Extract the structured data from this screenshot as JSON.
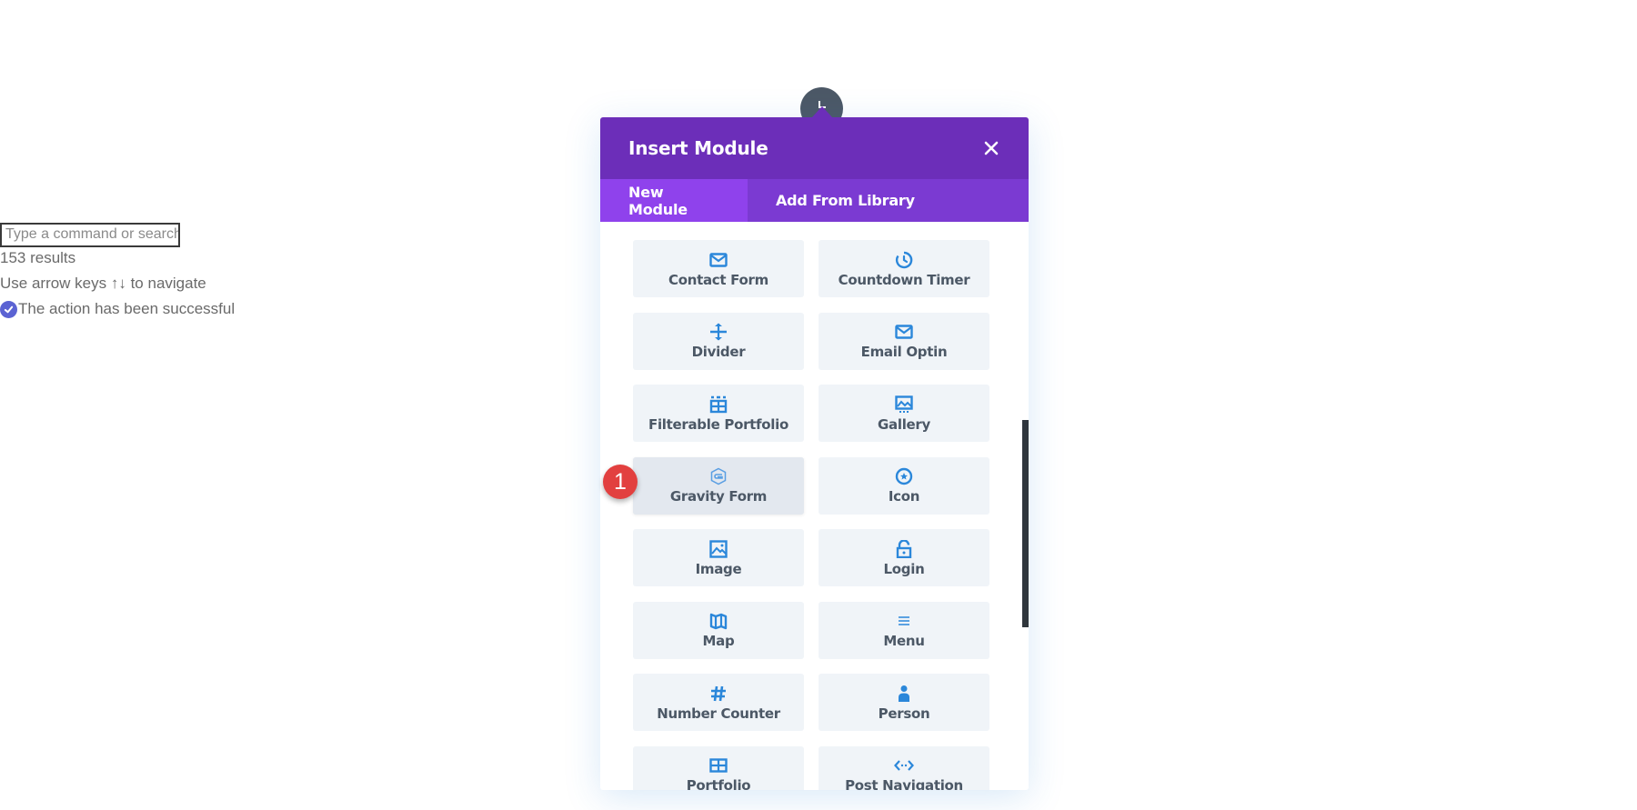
{
  "command_palette": {
    "input_placeholder": "Type a command or search",
    "results_text": "153 results",
    "nav_hint": "Use arrow keys ↑↓ to navigate",
    "status_text": "The action has been successful",
    "status_icon": "check-circle-icon"
  },
  "modal": {
    "title": "Insert Module",
    "close_icon": "close-icon",
    "tabs": [
      {
        "label": "New Module",
        "active": true
      },
      {
        "label": "Add From Library",
        "active": false
      }
    ],
    "modules": [
      {
        "label": "Contact Form",
        "icon": "envelope-icon"
      },
      {
        "label": "Countdown Timer",
        "icon": "timer-icon"
      },
      {
        "label": "Divider",
        "icon": "divider-icon"
      },
      {
        "label": "Email Optin",
        "icon": "envelope-icon"
      },
      {
        "label": "Filterable Portfolio",
        "icon": "filterable-grid-icon"
      },
      {
        "label": "Gallery",
        "icon": "gallery-icon"
      },
      {
        "label": "Gravity Form",
        "icon": "gravity-forms-icon",
        "hovered": true
      },
      {
        "label": "Icon",
        "icon": "star-circle-icon"
      },
      {
        "label": "Image",
        "icon": "image-icon"
      },
      {
        "label": "Login",
        "icon": "unlock-icon"
      },
      {
        "label": "Map",
        "icon": "map-icon"
      },
      {
        "label": "Menu",
        "icon": "menu-icon"
      },
      {
        "label": "Number Counter",
        "icon": "hash-icon"
      },
      {
        "label": "Person",
        "icon": "person-icon"
      },
      {
        "label": "Portfolio",
        "icon": "grid-icon"
      },
      {
        "label": "Post Navigation",
        "icon": "post-nav-icon"
      }
    ]
  },
  "step_badge": {
    "number": "1"
  },
  "colors": {
    "header": "#6c2eb9",
    "tabs_bg": "#7b3ad2",
    "tab_active": "#8f42ec",
    "icon_blue": "#2b87da",
    "module_bg": "#f0f4f8",
    "label": "#4c5866",
    "badge": "#e2403f"
  }
}
